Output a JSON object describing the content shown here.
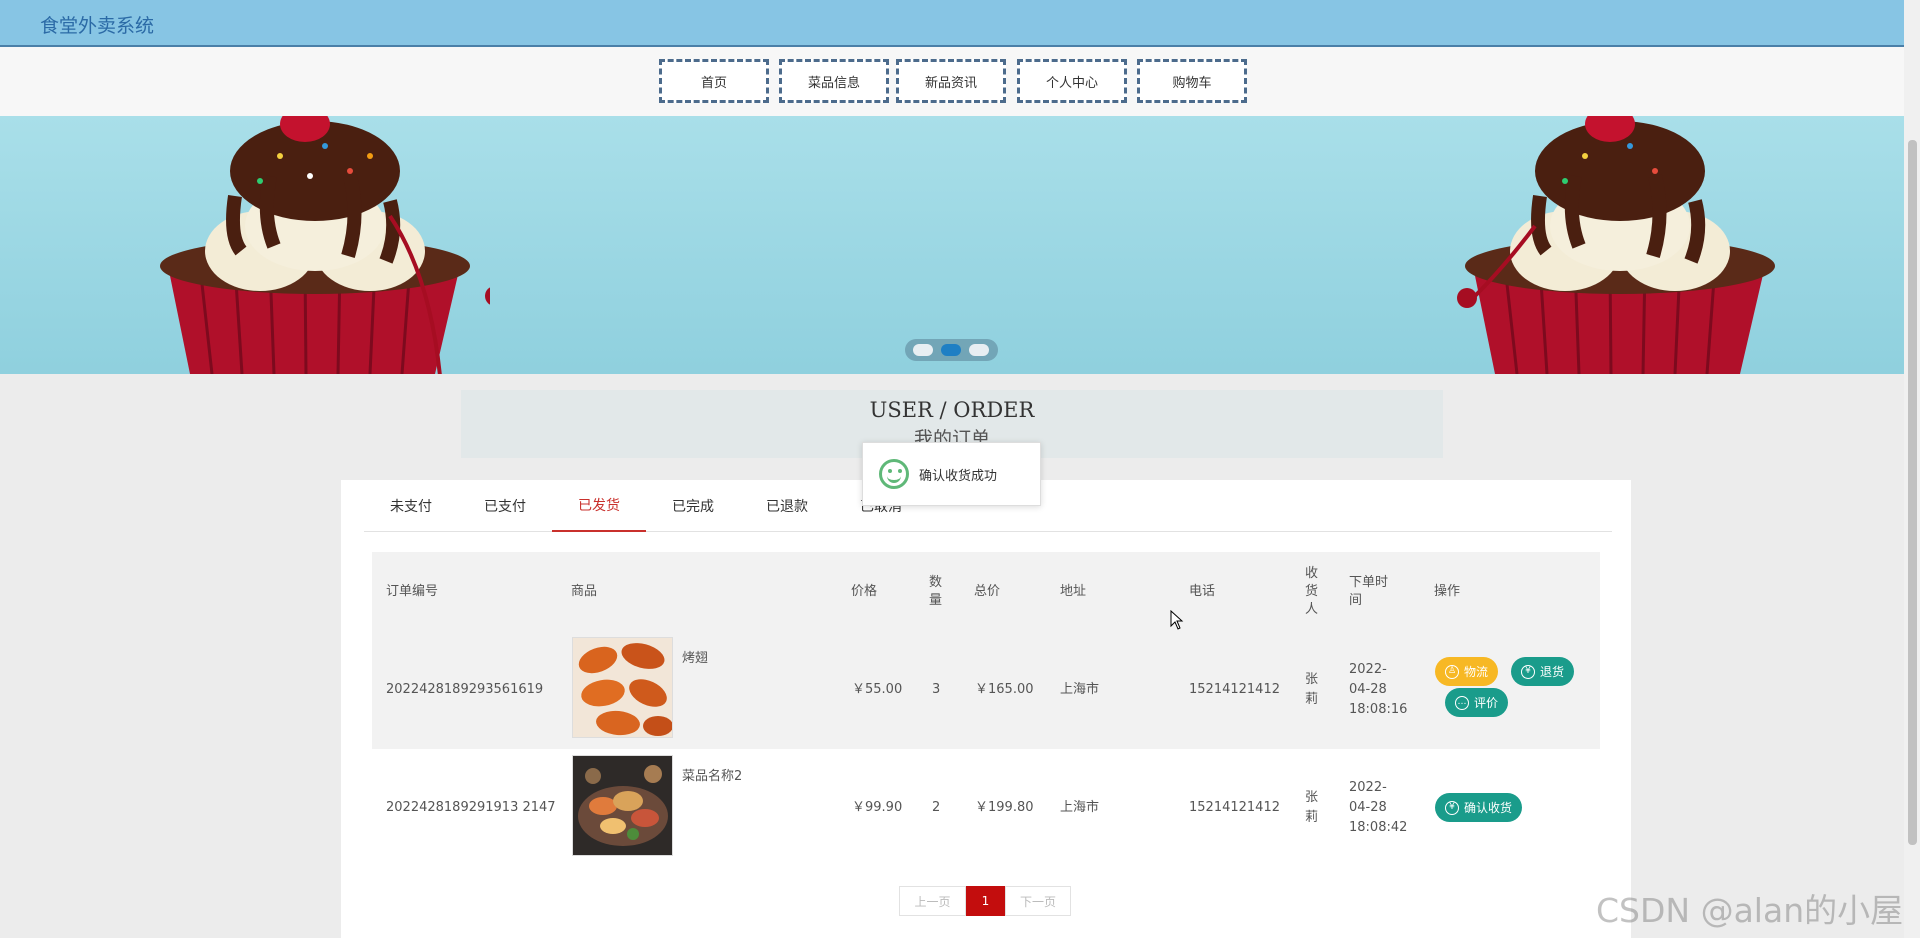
{
  "app": {
    "title": "食堂外卖系统"
  },
  "nav": {
    "items": [
      "首页",
      "菜品信息",
      "新品资讯",
      "个人中心",
      "购物车"
    ]
  },
  "colors": {
    "topbar": "#87c5e4",
    "accent_red": "#c9302c",
    "btn_green": "#1a9c8b",
    "btn_yellow": "#f7b824"
  },
  "heading": {
    "en": "USER / ORDER",
    "cn": "我的订单"
  },
  "toast": {
    "icon": "smile-icon",
    "message": "确认收货成功"
  },
  "tabs": {
    "items": [
      "未支付",
      "已支付",
      "已发货",
      "已完成",
      "已退款",
      "已取消"
    ],
    "active": "已发货"
  },
  "table": {
    "headers": {
      "order_no": "订单编号",
      "product": "商品",
      "price": "价格",
      "qty": "数量",
      "total": "总价",
      "address": "地址",
      "phone": "电话",
      "receiver": "收货人",
      "time": "下单时间",
      "actions": "操作"
    },
    "rows": [
      {
        "order_no": "20224281892935616 19",
        "order_display": "2022428189293561619",
        "product": "烤翅",
        "price": "￥55.00",
        "qty": "3",
        "total": "￥165.00",
        "address": "上海市",
        "phone": "15214121412",
        "receiver": "张莉",
        "time": "2022-04-28 18:08:16",
        "actions": [
          "物流",
          "退货",
          "评价"
        ]
      },
      {
        "order_no": "2022428189291913 2147",
        "order_display": "2022428189291913 2147",
        "product": "菜品名称2",
        "price": "￥99.90",
        "qty": "2",
        "total": "￥199.80",
        "address": "上海市",
        "phone": "15214121412",
        "receiver": "张莉",
        "time": "2022-04-28 18:08:42",
        "actions": [
          "确认收货"
        ]
      }
    ]
  },
  "pager": {
    "prev": "上一页",
    "current": "1",
    "next": "下一页"
  },
  "watermark": "CSDN @alan的小屋"
}
